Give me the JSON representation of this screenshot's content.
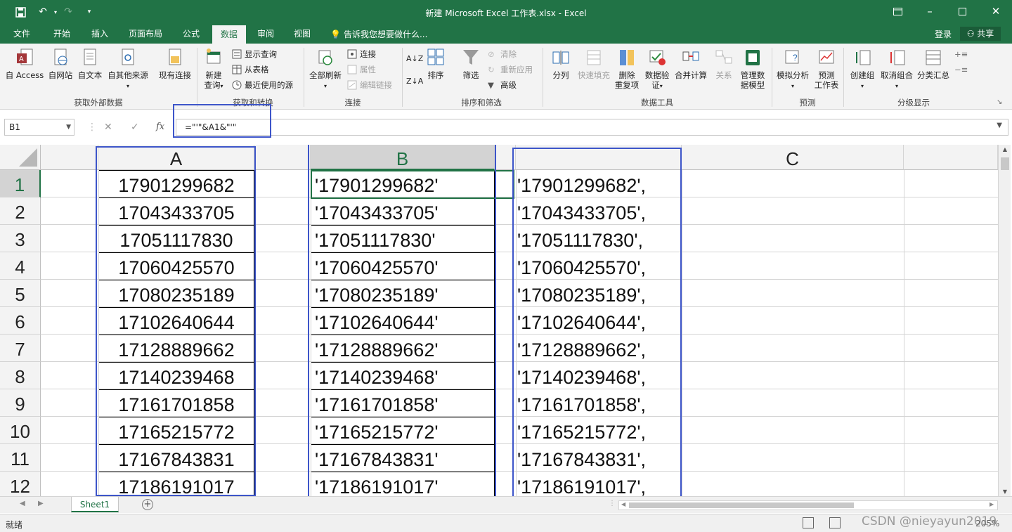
{
  "window": {
    "title": "新建 Microsoft Excel 工作表.xlsx - Excel"
  },
  "tabs": [
    "文件",
    "开始",
    "插入",
    "页面布局",
    "公式",
    "数据",
    "审阅",
    "视图"
  ],
  "active_tab": "数据",
  "tell_me": "告诉我您想要做什么...",
  "login": "登录",
  "share": "共享",
  "ribbon": {
    "ext_data": {
      "access": "自 Access",
      "web": "自网站",
      "text": "自文本",
      "other": "自其他来源",
      "existing": "现有连接",
      "group": "获取外部数据"
    },
    "transform": {
      "new_query_1": "新建",
      "new_query_2": "查询",
      "show_queries": "显示查询",
      "from_table": "从表格",
      "recent_sources": "最近使用的源",
      "group": "获取和转换"
    },
    "connections": {
      "refresh_all": "全部刷新",
      "connections": "连接",
      "properties": "属性",
      "edit_links": "编辑链接",
      "group": "连接"
    },
    "sort_filter": {
      "sort": "排序",
      "filter": "筛选",
      "clear": "清除",
      "reapply": "重新应用",
      "advanced": "高级",
      "group": "排序和筛选"
    },
    "data_tools": {
      "split": "分列",
      "flash_fill": "快速填充",
      "remove_dup_1": "删除",
      "remove_dup_2": "重复项",
      "validation_1": "数据验",
      "validation_2": "证",
      "consolidate": "合并计算",
      "relationships": "关系",
      "model_1": "管理数",
      "model_2": "据模型",
      "group": "数据工具"
    },
    "forecast": {
      "what_if": "模拟分析",
      "sheet_1": "预测",
      "sheet_2": "工作表",
      "group": "预测"
    },
    "outline": {
      "group_btn": "创建组",
      "ungroup": "取消组合",
      "subtotal": "分类汇总",
      "group": "分级显示"
    }
  },
  "formula_bar": {
    "name_box": "B1",
    "formula": "=\"'\"&A1&\"'\""
  },
  "columns": [
    "A",
    "B",
    "C"
  ],
  "rows": [
    {
      "n": "1",
      "a": "17901299682",
      "b": "'17901299682'",
      "c": "'17901299682',"
    },
    {
      "n": "2",
      "a": "17043433705",
      "b": "'17043433705'",
      "c": "'17043433705',"
    },
    {
      "n": "3",
      "a": "17051117830",
      "b": "'17051117830'",
      "c": "'17051117830',"
    },
    {
      "n": "4",
      "a": "17060425570",
      "b": "'17060425570'",
      "c": "'17060425570',"
    },
    {
      "n": "5",
      "a": "17080235189",
      "b": "'17080235189'",
      "c": "'17080235189',"
    },
    {
      "n": "6",
      "a": "17102640644",
      "b": "'17102640644'",
      "c": "'17102640644',"
    },
    {
      "n": "7",
      "a": "17128889662",
      "b": "'17128889662'",
      "c": "'17128889662',"
    },
    {
      "n": "8",
      "a": "17140239468",
      "b": "'17140239468'",
      "c": "'17140239468',"
    },
    {
      "n": "9",
      "a": "17161701858",
      "b": "'17161701858'",
      "c": "'17161701858',"
    },
    {
      "n": "10",
      "a": "17165215772",
      "b": "'17165215772'",
      "c": "'17165215772',"
    },
    {
      "n": "11",
      "a": "17167843831",
      "b": "'17167843831'",
      "c": "'17167843831',"
    },
    {
      "n": "12",
      "a": "17186191017",
      "b": "'17186191017'",
      "c": "'17186191017',"
    }
  ],
  "sheet_tab": "Sheet1",
  "status": "就绪",
  "zoom": "205%",
  "watermark": "CSDN @nieyayun2019",
  "colors": {
    "excel_green": "#217346",
    "highlight_blue": "#3d55c9"
  }
}
